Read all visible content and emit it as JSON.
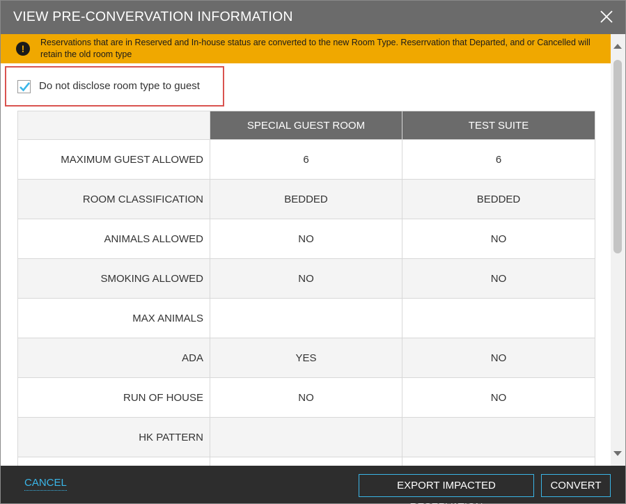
{
  "dialog": {
    "title": "VIEW PRE-CONVERVATION INFORMATION"
  },
  "warning": {
    "text": "Reservations that are in Reserved and In-house status are converted to the new Room Type. Reserrvation that Departed, and or Cancelled will retain the old room type",
    "icon_glyph": "!"
  },
  "disclose": {
    "label": "Do not disclose room type to guest",
    "checked": true
  },
  "table": {
    "columns": [
      "",
      "SPECIAL GUEST ROOM",
      "TEST SUITE"
    ],
    "rows": [
      {
        "label": "MAXIMUM GUEST ALLOWED",
        "values": [
          "6",
          "6"
        ]
      },
      {
        "label": "ROOM CLASSIFICATION",
        "values": [
          "BEDDED",
          "BEDDED"
        ]
      },
      {
        "label": "ANIMALS ALLOWED",
        "values": [
          "NO",
          "NO"
        ]
      },
      {
        "label": "SMOKING ALLOWED",
        "values": [
          "NO",
          "NO"
        ]
      },
      {
        "label": "MAX ANIMALS",
        "values": [
          "",
          ""
        ]
      },
      {
        "label": "ADA",
        "values": [
          "YES",
          "NO"
        ]
      },
      {
        "label": "RUN OF HOUSE",
        "values": [
          "NO",
          "NO"
        ]
      },
      {
        "label": "HK PATTERN",
        "values": [
          "",
          ""
        ]
      },
      {
        "label": "",
        "values": [
          "",
          ""
        ]
      }
    ]
  },
  "footer": {
    "cancel_label": "CANCEL",
    "export_label": "EXPORT IMPACTED RESERVATION",
    "convert_label": "CONVERT"
  },
  "colors": {
    "title_bar": "#6b6b6b",
    "warning": "#f0a800",
    "accent": "#3ab6e8",
    "highlight_border": "#d9534f",
    "footer": "#2d2d2d"
  },
  "icons": {
    "close": "close-icon",
    "warning": "exclamation-circle-icon",
    "check": "checkmark-icon"
  }
}
